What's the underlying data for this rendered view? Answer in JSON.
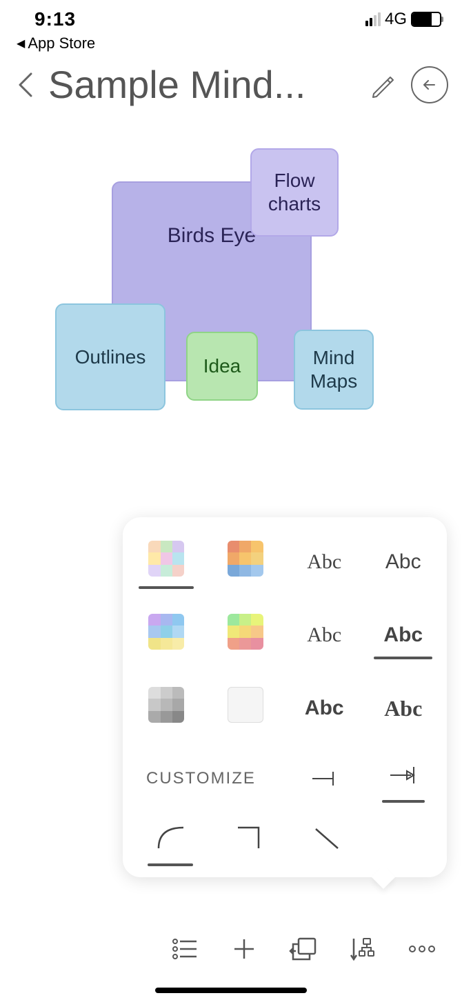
{
  "status": {
    "time": "9:13",
    "network": "4G"
  },
  "backApp": {
    "label": "App Store"
  },
  "header": {
    "title": "Sample Mind..."
  },
  "nodes": {
    "birds": "Birds Eye",
    "flow": "Flow\ncharts",
    "outlines": "Outlines",
    "idea": "Idea",
    "mindmaps": "Mind\nMaps"
  },
  "panel": {
    "fonts": [
      "Abc",
      "Abc",
      "Abc",
      "Abc",
      "Abc",
      "Abc"
    ],
    "customize": "CUSTOMIZE"
  }
}
